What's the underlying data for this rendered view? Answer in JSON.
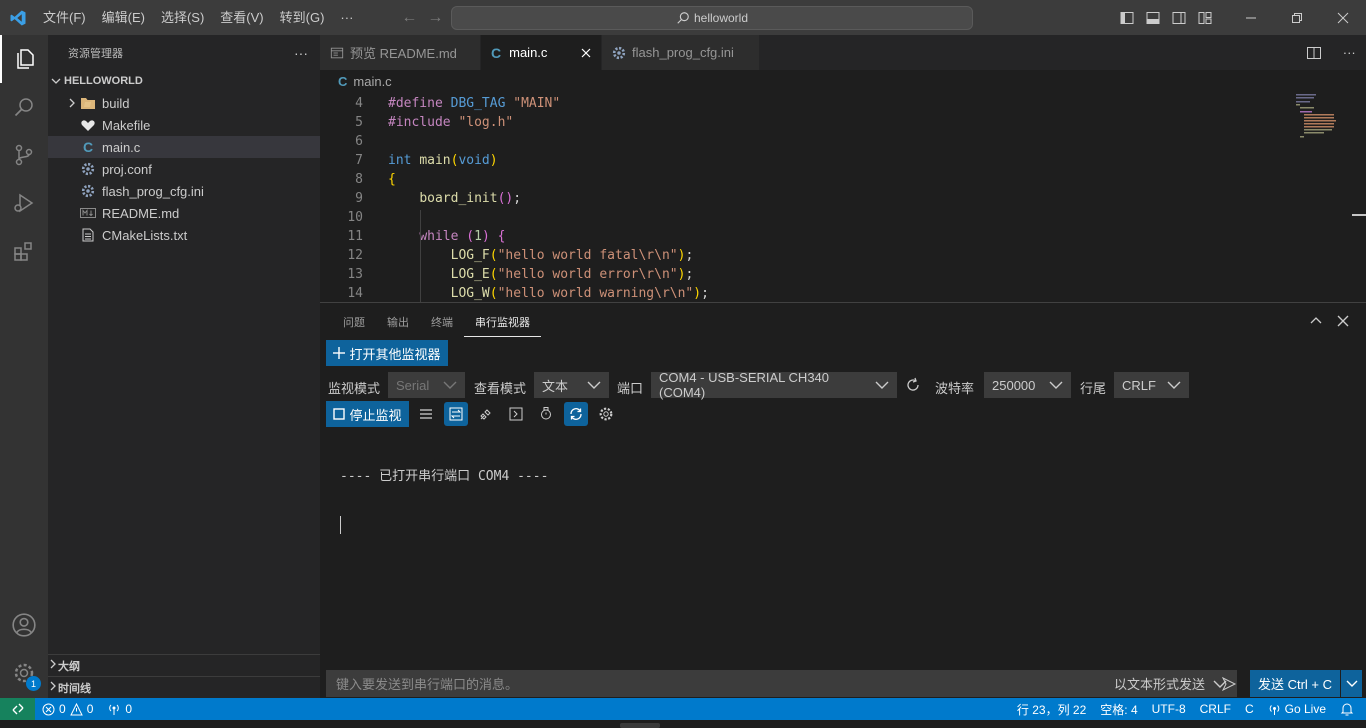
{
  "titlebar": {
    "menus": [
      "文件(F)",
      "编辑(E)",
      "选择(S)",
      "查看(V)",
      "转到(G)",
      "···"
    ],
    "search": "helloworld"
  },
  "sidebar": {
    "title": "资源管理器",
    "more": "···",
    "root": "HELLOWORLD",
    "items": [
      {
        "label": "build",
        "type": "folder"
      },
      {
        "label": "Makefile",
        "type": "makefile"
      },
      {
        "label": "main.c",
        "type": "c"
      },
      {
        "label": "proj.conf",
        "type": "gear"
      },
      {
        "label": "flash_prog_cfg.ini",
        "type": "gear"
      },
      {
        "label": "README.md",
        "type": "md"
      },
      {
        "label": "CMakeLists.txt",
        "type": "txt"
      }
    ],
    "outline": "大纲",
    "timeline": "时间线"
  },
  "tabs": [
    {
      "label": "预览 README.md"
    },
    {
      "label": "main.c"
    },
    {
      "label": "flash_prog_cfg.ini"
    }
  ],
  "breadcrumb": "main.c",
  "editor": {
    "line_numbers": [
      "4",
      "5",
      "6",
      "7",
      "8",
      "9",
      "10",
      "11",
      "12",
      "13",
      "14"
    ]
  },
  "panel": {
    "tabs": [
      "问题",
      "输出",
      "终端",
      "串行监视器"
    ],
    "open_monitor": "打开其他监视器",
    "monitor_mode_label": "监视模式",
    "monitor_mode_value": "Serial",
    "view_mode_label": "查看模式",
    "view_mode_value": "文本",
    "port_label": "端口",
    "port_value": "COM4 - USB-SERIAL CH340 (COM4)",
    "baud_label": "波特率",
    "baud_value": "250000",
    "line_end_label": "行尾",
    "line_end_value": "CRLF",
    "stop_button": "停止监视",
    "output_line": "---- 已打开串行端口 COM4 ----",
    "send_placeholder": "键入要发送到串行端口的消息。",
    "send_mode": "以文本形式发送",
    "send_button": "发送 Ctrl + C"
  },
  "statusbar": {
    "errors": "0",
    "warnings": "0",
    "ports": "0",
    "position": "行 23，列 22",
    "spaces": "空格: 4",
    "encoding": "UTF-8",
    "eol": "CRLF",
    "language": "C",
    "golive": "Go Live"
  },
  "accounts_badge": "1",
  "colors": {
    "accent": "#007acc",
    "button": "#0e639c",
    "titlebar": "#3c3c3c"
  }
}
